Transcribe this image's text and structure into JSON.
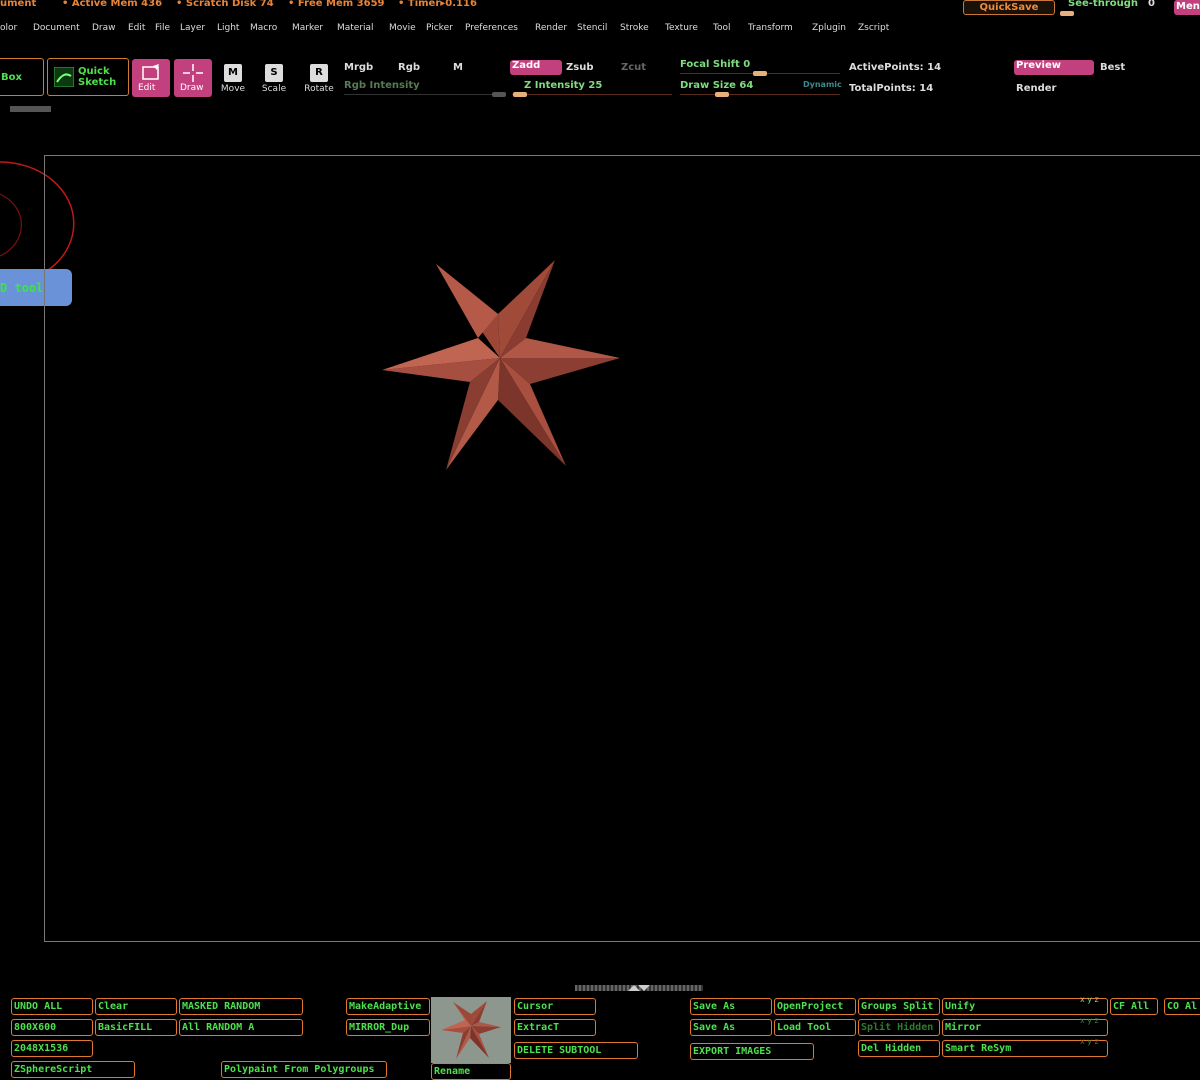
{
  "status": {
    "document": "ument",
    "active_mem": "• Active Mem 436",
    "scratch_disk": "• Scratch Disk 74",
    "free_mem": "• Free Mem 3659",
    "timer": "• Timer▸0.116",
    "quicksave": "QuickSave",
    "see_through_label": "See-through",
    "see_through_value": "0",
    "menus": "Menu"
  },
  "menubar": [
    "olor",
    "Document",
    "Draw",
    "Edit",
    "File",
    "Layer",
    "Light",
    "Macro",
    "Marker",
    "Material",
    "Movie",
    "Picker",
    "Preferences",
    "Render",
    "Stencil",
    "Stroke",
    "Texture",
    "Tool",
    "Transform",
    "Zplugin",
    "Zscript"
  ],
  "toolbar": {
    "lightbox": "Box",
    "quick_sketch_1": "Quick",
    "quick_sketch_2": "Sketch",
    "edit": "Edit",
    "draw": "Draw",
    "move": "Move",
    "move_key": "M",
    "scale": "Scale",
    "scale_key": "S",
    "rotate": "Rotate",
    "rotate_key": "R",
    "mrgb": "Mrgb",
    "rgb": "Rgb",
    "m": "M",
    "rgb_intensity": "Rgb Intensity",
    "zadd": "Zadd",
    "zsub": "Zsub",
    "zcut": "Zcut",
    "z_intensity": "Z Intensity 25",
    "z_intensity_value": 25,
    "focal_shift": "Focal Shift 0",
    "draw_size": "Draw Size 64",
    "dynamic": "Dynamic",
    "active_points": "ActivePoints: 14",
    "total_points": "TotalPoints: 14",
    "preview": "Preview",
    "best": "Best",
    "render": "Render"
  },
  "left_panel": {
    "tool_label": "D tool"
  },
  "canvas": {
    "star_color": "#a14a3a"
  },
  "bottom": {
    "undo_all": "UNDO ALL",
    "clear": "Clear",
    "masked_random": "MASKED RANDOM",
    "res_800": "800X600",
    "basic_fill": "BasicFILL",
    "all_random": "All RANDOM A",
    "res_2048": "2048X1536",
    "zsphere_script": "ZSphereScript",
    "polypaint": "Polypaint From Polygroups",
    "make_adaptive": "MakeAdaptive",
    "mirror_dup": "MIRROR_Dup",
    "rename": "Rename",
    "cursor": "Cursor",
    "extract": "ExtracT",
    "delete_subtool": "DELETE SUBTOOL",
    "save_as_1": "Save As",
    "open_project": "OpenProject",
    "save_as_2": "Save As",
    "load_tool": "Load Tool",
    "export_images": "EXPORT IMAGES",
    "groups_split": "Groups Split",
    "split_hidden": "Split Hidden",
    "del_hidden": "Del Hidden",
    "unify": "Unify",
    "mirror": "Mirror",
    "smart_resym": "Smart ReSym",
    "cf_all": "CF All",
    "co_all": "CO Al"
  }
}
